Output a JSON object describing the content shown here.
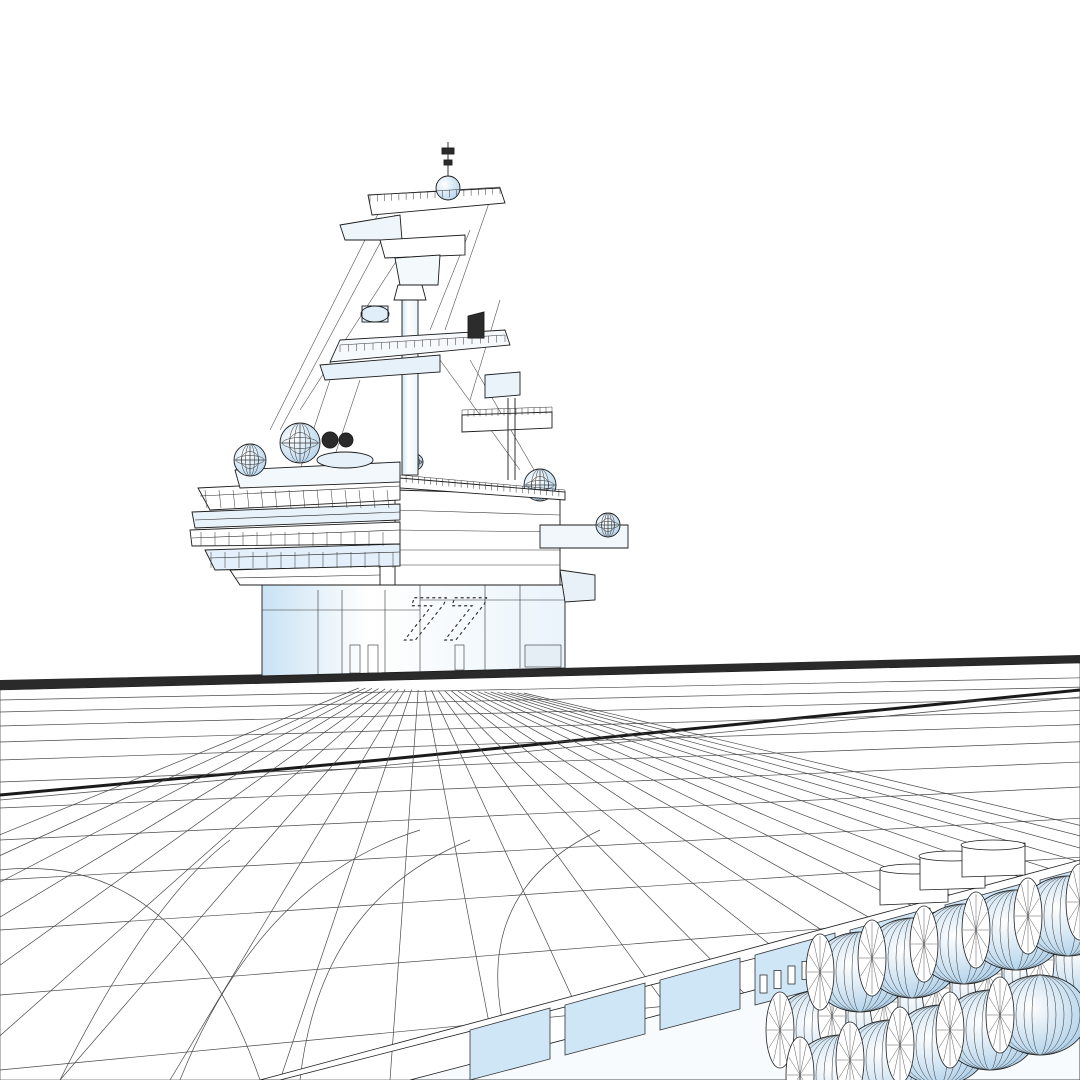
{
  "scene": {
    "hull_number": "77",
    "colors": {
      "background": "#ffffff",
      "line": "#1c1c1c",
      "line_light": "#6a6a6a",
      "tint": "#cfe6f6",
      "tint_dark": "#a9cde8"
    }
  }
}
